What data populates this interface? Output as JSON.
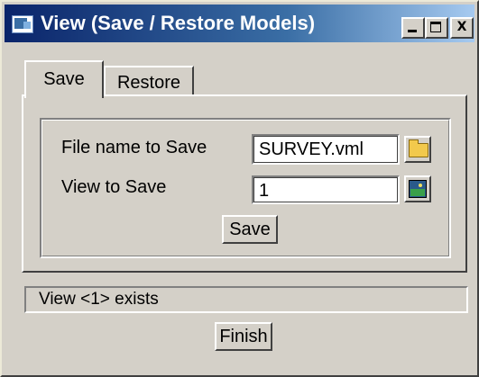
{
  "window": {
    "title": "View (Save / Restore Models)",
    "minimize_label": "_",
    "maximize_label": "",
    "close_label": "X"
  },
  "tabs": [
    {
      "label": "Save",
      "active": true
    },
    {
      "label": "Restore",
      "active": false
    }
  ],
  "save_panel": {
    "file_name_label": "File name to Save",
    "file_name_value": "SURVEY.vml",
    "file_browse_icon": "folder-icon",
    "view_label": "View to Save",
    "view_value": "1",
    "view_pick_icon": "view-picture-icon",
    "save_button": "Save"
  },
  "status": {
    "message": "View <1> exists"
  },
  "finish_button": "Finish"
}
